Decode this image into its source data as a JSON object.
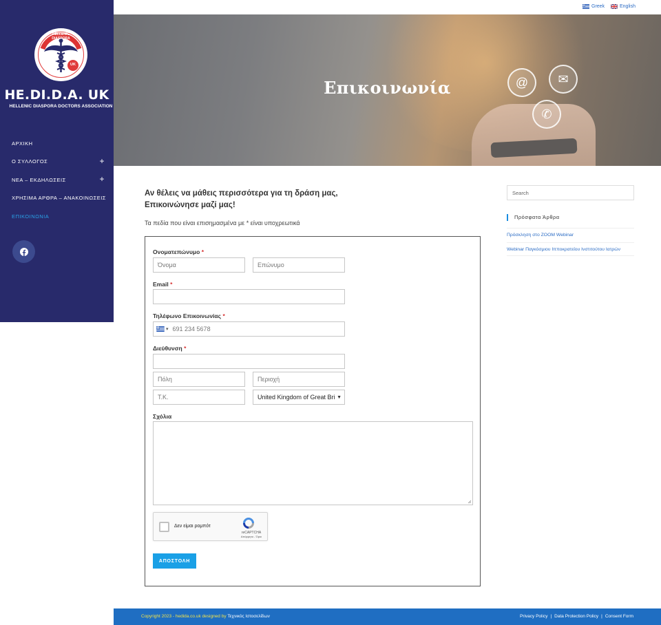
{
  "sidebar": {
    "logo_ring_text": "HELLENIC DIASPORA",
    "logo_badge": "UK",
    "brand": "HE.DI.D.A. UK",
    "brand_sub": "HELLENIC DIASPORA DOCTORS ASSOCIATION",
    "nav": [
      {
        "label": "ΑΡΧΙΚΗ",
        "has_submenu": false,
        "active": false
      },
      {
        "label": "Ο ΣΥΛΛΟΓΟΣ",
        "has_submenu": true,
        "active": false
      },
      {
        "label": "ΝΕΑ – ΕΚΔΗΛΩΣΕΙΣ",
        "has_submenu": true,
        "active": false
      },
      {
        "label": "ΧΡΗΣΙΜΑ ΑΡΘΡΑ – ΑΝΑΚΟΙΝΩΣΕΙΣ",
        "has_submenu": false,
        "active": false
      },
      {
        "label": "ΕΠΙΚΟΙΝΩΝΙΑ",
        "has_submenu": false,
        "active": true
      }
    ],
    "plus_glyph": "+",
    "social_icon": "facebook-icon"
  },
  "topbar": {
    "languages": [
      {
        "label": "Greek",
        "flag": "greece-flag-icon"
      },
      {
        "label": "English",
        "flag": "uk-flag-icon"
      }
    ]
  },
  "hero": {
    "title": "Επικοινωνία",
    "icons": [
      "at-sign-icon",
      "envelope-icon",
      "phone-icon"
    ]
  },
  "main": {
    "heading_line1": "Αν θέλεις να μάθεις περισσότερα για τη δράση μας,",
    "heading_line2": "Επικοινώνησε μαζί μας!",
    "required_note": "Τα πεδία που είναι επισημασμένα με * είναι υποχρεωτικά"
  },
  "form": {
    "required_mark": "*",
    "name_label": "Ονοματεπώνυμο",
    "first_name_placeholder": "Όνομα",
    "last_name_placeholder": "Επώνυμο",
    "email_label": "Email",
    "phone_label": "Τηλέφωνο Επικοινωνίας",
    "phone_placeholder": "691 234 5678",
    "phone_country_caret": "▾",
    "address_label": "Διεύθυνση",
    "city_placeholder": "Πόλη",
    "region_placeholder": "Περιοχή",
    "postcode_placeholder": "Τ.Κ.",
    "country_value": "United Kingdom of Great Britain",
    "comments_label": "Σχόλια",
    "recaptcha_text": "Δεν είμαι ρομπότ",
    "recaptcha_brand": "reCAPTCHA",
    "recaptcha_links": "Απόρρητο - Όροι",
    "submit_label": "ΑΠΟΣΤΟΛΗ"
  },
  "right_sidebar": {
    "search_placeholder": "Search",
    "recent_title": "Πρόσφατα Άρθρα",
    "recent_posts": [
      "Πρόσκληση στο ZOOM Webinar",
      "Webinar Παγκόσμιου Ιπποκρατείου Ινστιτούτου Ιατρών"
    ]
  },
  "footer": {
    "copyright": "Copyright 2023 - hedida.co.uk designed by",
    "designer": "Τεχνικός Ιστοσελίδων",
    "links": [
      "Privacy Policy",
      "Data Protection Policy",
      "Consent Form"
    ],
    "separator": "|"
  },
  "colors": {
    "sidebar_bg": "#282a6b",
    "active_nav": "#2aa3e8",
    "required": "#d63232",
    "submit_bg": "#1aa0e6",
    "footer_bg": "#1f6ec2",
    "link": "#2a6bc4"
  }
}
